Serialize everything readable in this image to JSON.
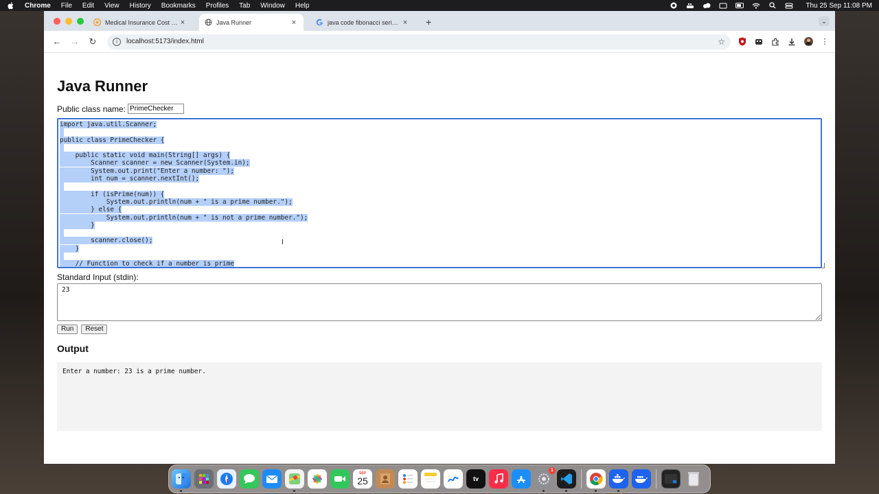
{
  "menubar": {
    "app_name": "Chrome",
    "items": [
      "File",
      "Edit",
      "View",
      "History",
      "Bookmarks",
      "Profiles",
      "Tab",
      "Window",
      "Help"
    ],
    "clock": "Thu 25 Sep  11:08 PM"
  },
  "browser": {
    "tabs": [
      {
        "title": "Medical Insurance Cost Datas",
        "icon": "kaggle-icon"
      },
      {
        "title": "Java Runner",
        "icon": "globe-icon"
      },
      {
        "title": "java code fibonacci series - G",
        "icon": "google-icon"
      }
    ],
    "url": "localhost:5173/index.html"
  },
  "page": {
    "title": "Java Runner",
    "class_name_label": "Public class name:",
    "class_name_value": "PrimeChecker",
    "code_lines": [
      "import java.util.Scanner;",
      "",
      "public class PrimeChecker {",
      "",
      "    public static void main(String[] args) {",
      "        Scanner scanner = new Scanner(System.in);",
      "        System.out.print(\"Enter a number: \");",
      "        int num = scanner.nextInt();",
      "",
      "        if (isPrime(num)) {",
      "            System.out.println(num + \" is a prime number.\");",
      "        } else {",
      "            System.out.println(num + \" is not a prime number.\");",
      "        }",
      "",
      "        scanner.close();",
      "    }",
      "",
      "    // Function to check if a number is prime"
    ],
    "stdin_label": "Standard Input (stdin):",
    "stdin_value": "23",
    "run_label": "Run",
    "reset_label": "Reset",
    "output_heading": "Output",
    "output_text": "Enter a number: 23 is a prime number."
  },
  "dock": {
    "calendar_month": "SEP",
    "calendar_day": "25",
    "settings_badge": "1"
  }
}
